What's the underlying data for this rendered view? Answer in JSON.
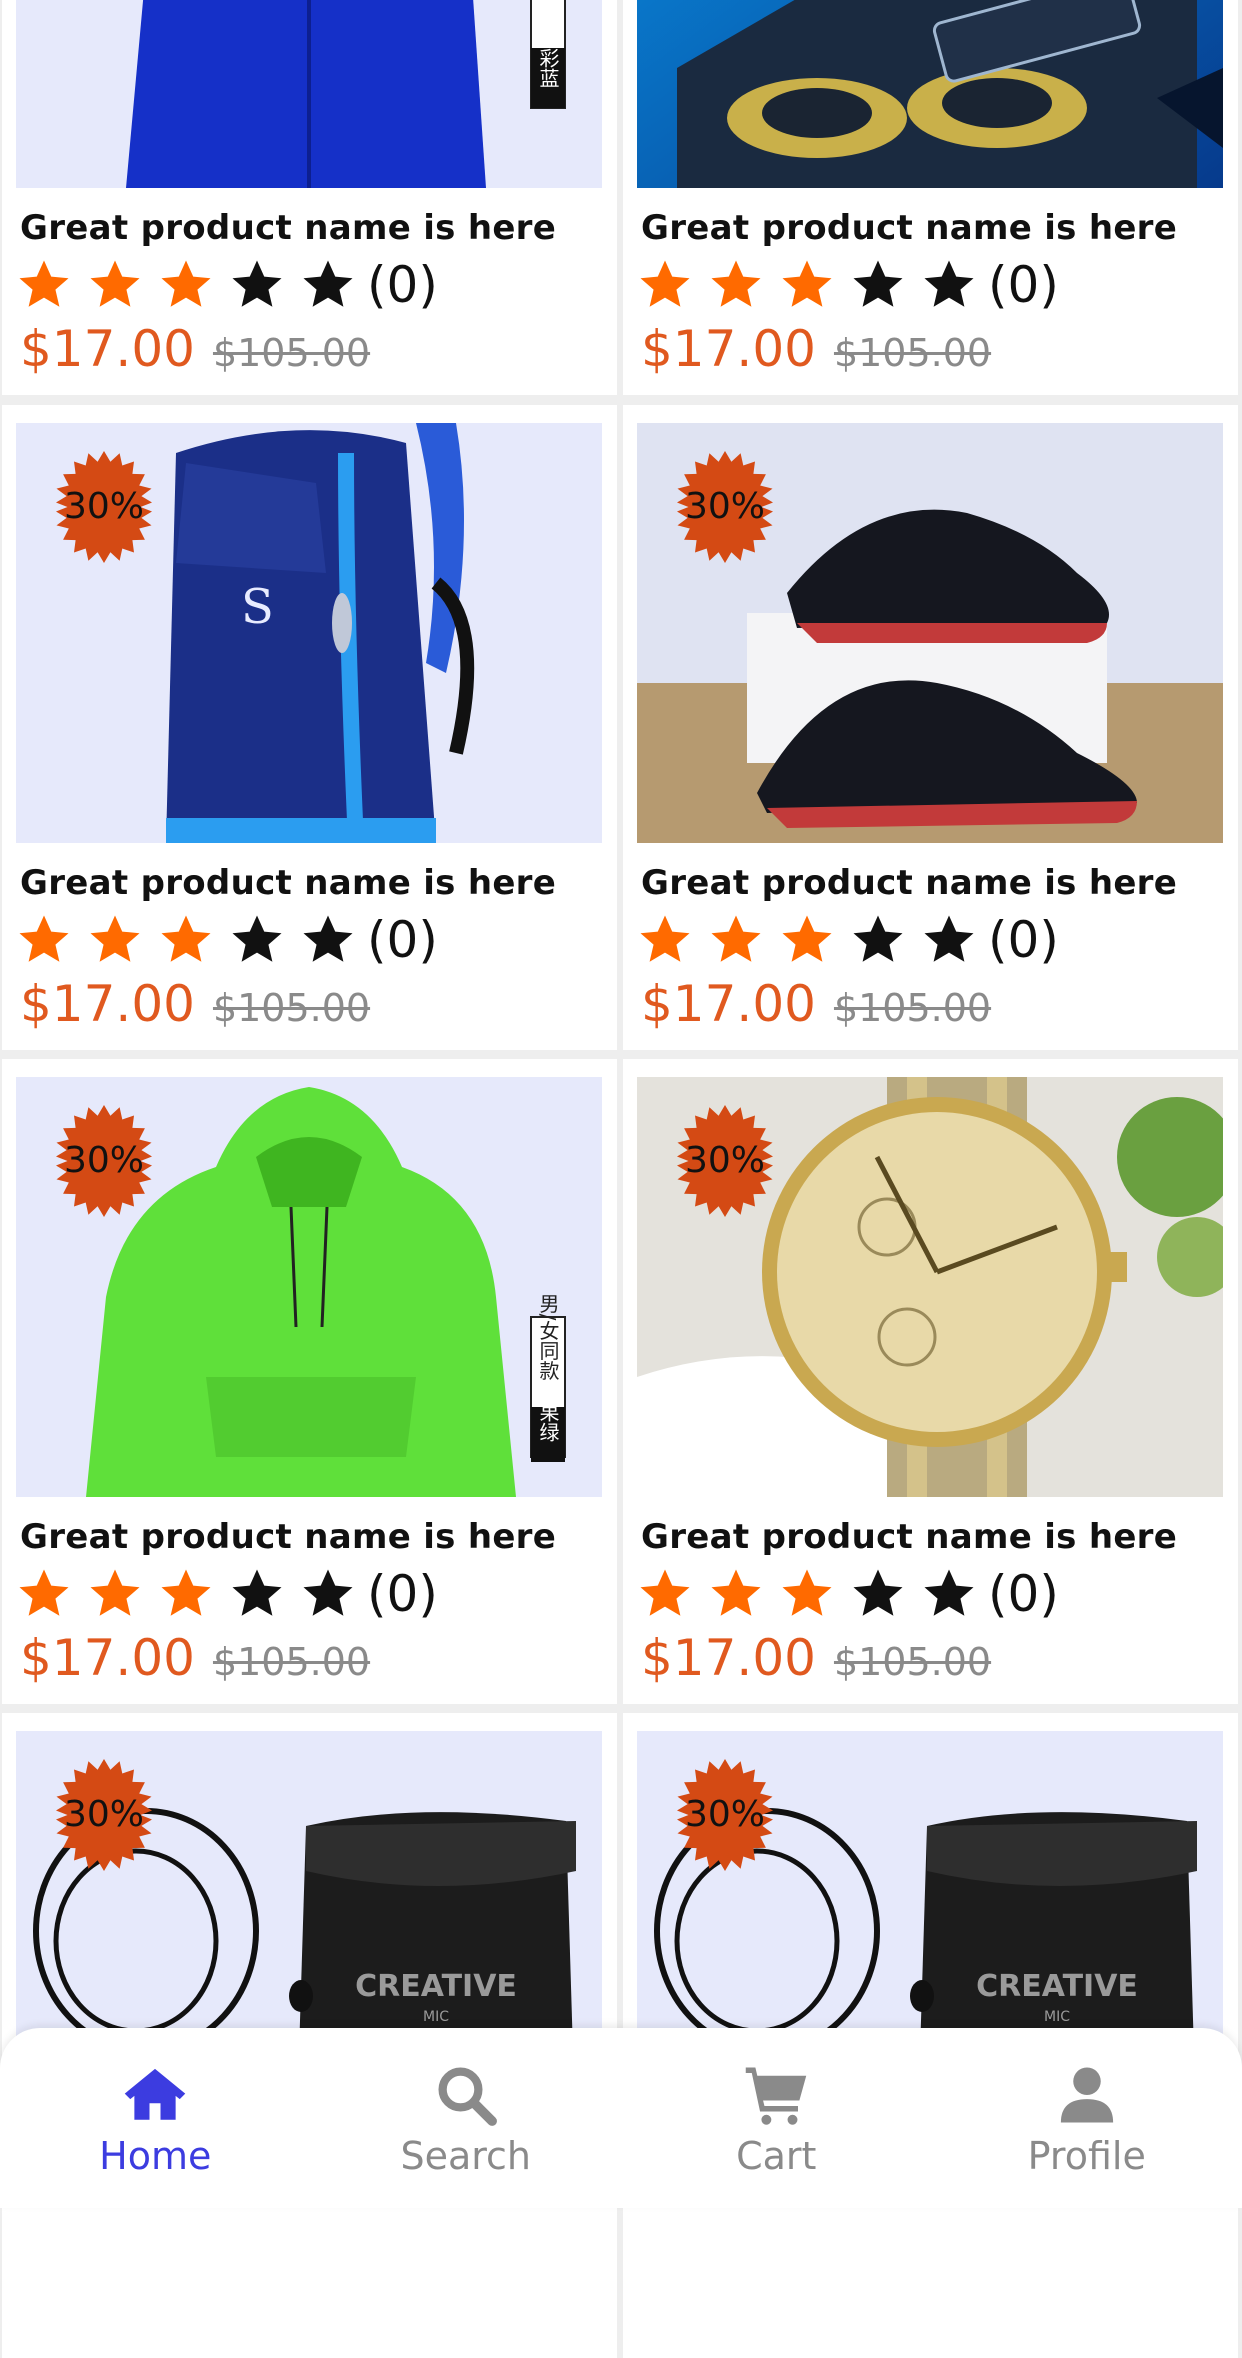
{
  "products": [
    {
      "name": "Great product name is here",
      "rating_count": "(0)",
      "price": "$17.00",
      "old_price": "$105.00",
      "badge": "",
      "stars_filled": 3,
      "image": "blue-hoodie"
    },
    {
      "name": "Great product name is here",
      "rating_count": "(0)",
      "price": "$17.00",
      "old_price": "$105.00",
      "badge": "",
      "stars_filled": 3,
      "image": "earbuds"
    },
    {
      "name": "Great product name is here",
      "rating_count": "(0)",
      "price": "$17.00",
      "old_price": "$105.00",
      "badge": "30%",
      "stars_filled": 3,
      "image": "backpack"
    },
    {
      "name": "Great product name is here",
      "rating_count": "(0)",
      "price": "$17.00",
      "old_price": "$105.00",
      "badge": "30%",
      "stars_filled": 3,
      "image": "sneakers"
    },
    {
      "name": "Great product name is here",
      "rating_count": "(0)",
      "price": "$17.00",
      "old_price": "$105.00",
      "badge": "30%",
      "stars_filled": 3,
      "image": "green-hoodie"
    },
    {
      "name": "Great product name is here",
      "rating_count": "(0)",
      "price": "$17.00",
      "old_price": "$105.00",
      "badge": "30%",
      "stars_filled": 3,
      "image": "watch"
    },
    {
      "name": "",
      "rating_count": "",
      "price": "",
      "old_price": "",
      "badge": "30%",
      "stars_filled": 3,
      "image": "earphones-case"
    },
    {
      "name": "",
      "rating_count": "",
      "price": "",
      "old_price": "",
      "badge": "30%",
      "stars_filled": 3,
      "image": "earphones-case"
    }
  ],
  "hoodie_tag": {
    "line1": "男/女同款",
    "blue_color": "彩蓝",
    "green_color": "果绿"
  },
  "case_brand": {
    "brand": "CREATIVE",
    "sub": "MIC"
  },
  "nav": [
    {
      "label": "Home",
      "icon": "home-icon",
      "active": true
    },
    {
      "label": "Search",
      "icon": "search-icon",
      "active": false
    },
    {
      "label": "Cart",
      "icon": "cart-icon",
      "active": false
    },
    {
      "label": "Profile",
      "icon": "profile-icon",
      "active": false
    }
  ],
  "colors": {
    "accent": "#3c3ce0",
    "price": "#e0591f",
    "star_filled": "#ff6a00",
    "star_empty": "#111111",
    "badge": "#d44a14",
    "inactive": "#8a8a8a"
  }
}
